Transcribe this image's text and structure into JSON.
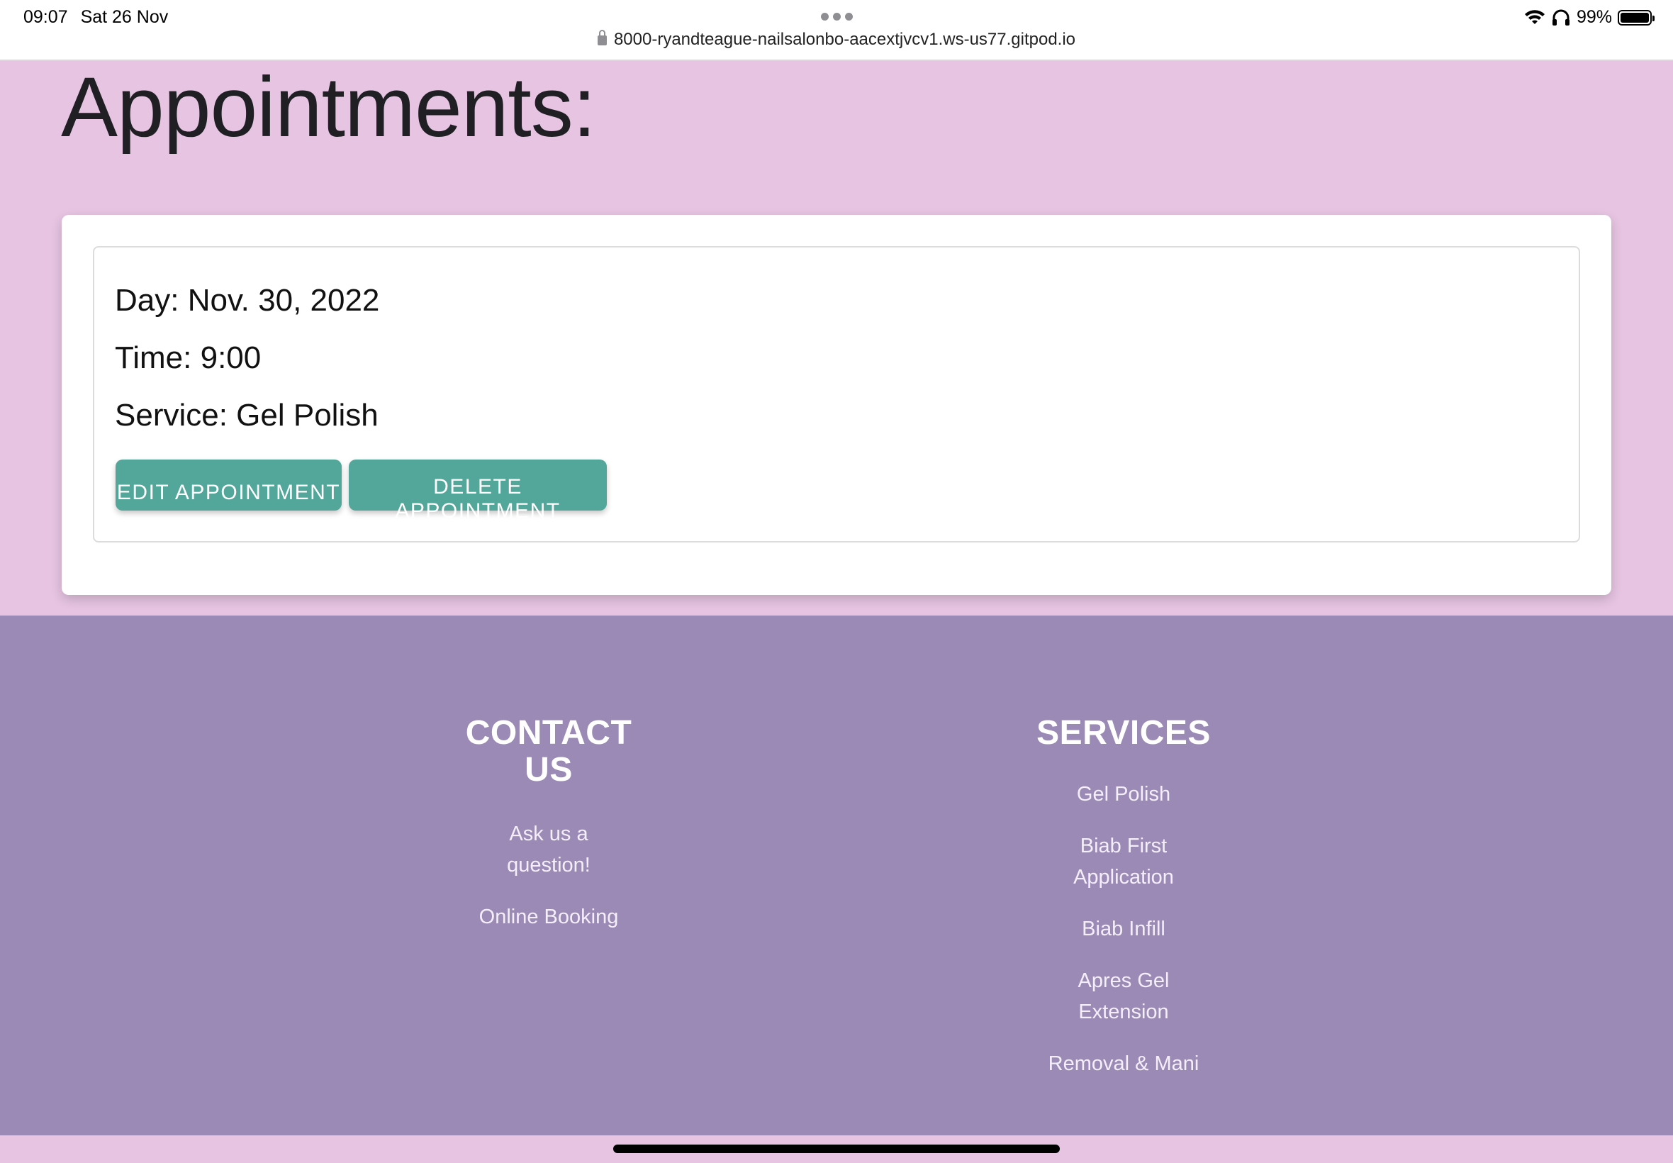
{
  "status_bar": {
    "time": "09:07",
    "date": "Sat 26 Nov",
    "url": "8000-ryandteague-nailsalonbo-aacextjvcv1.ws-us77.gitpod.io",
    "battery": "99%",
    "icons": [
      "wifi-icon",
      "headphones-icon",
      "battery-icon",
      "lock-icon"
    ]
  },
  "page": {
    "title": "Appointments:"
  },
  "appointment": {
    "day": "Day: Nov. 30, 2022",
    "time": "Time: 9:00",
    "service": "Service: Gel Polish",
    "edit_label": "EDIT APPOINTMENT",
    "delete_label": "DELETE APPOINTMENT"
  },
  "footer": {
    "contact": {
      "heading_line1": "CONTACT",
      "heading_line2": "US",
      "links": [
        "Ask us a question!",
        "Online Booking"
      ]
    },
    "services": {
      "heading": "SERVICES",
      "links": [
        "Gel Polish",
        "Biab First Application",
        "Biab Infill",
        "Apres Gel Extension",
        "Removal & Mani"
      ]
    }
  },
  "colors": {
    "page_background": "#e6c4e2",
    "footer_background": "#9b8ab6",
    "button": "#52a69a"
  }
}
